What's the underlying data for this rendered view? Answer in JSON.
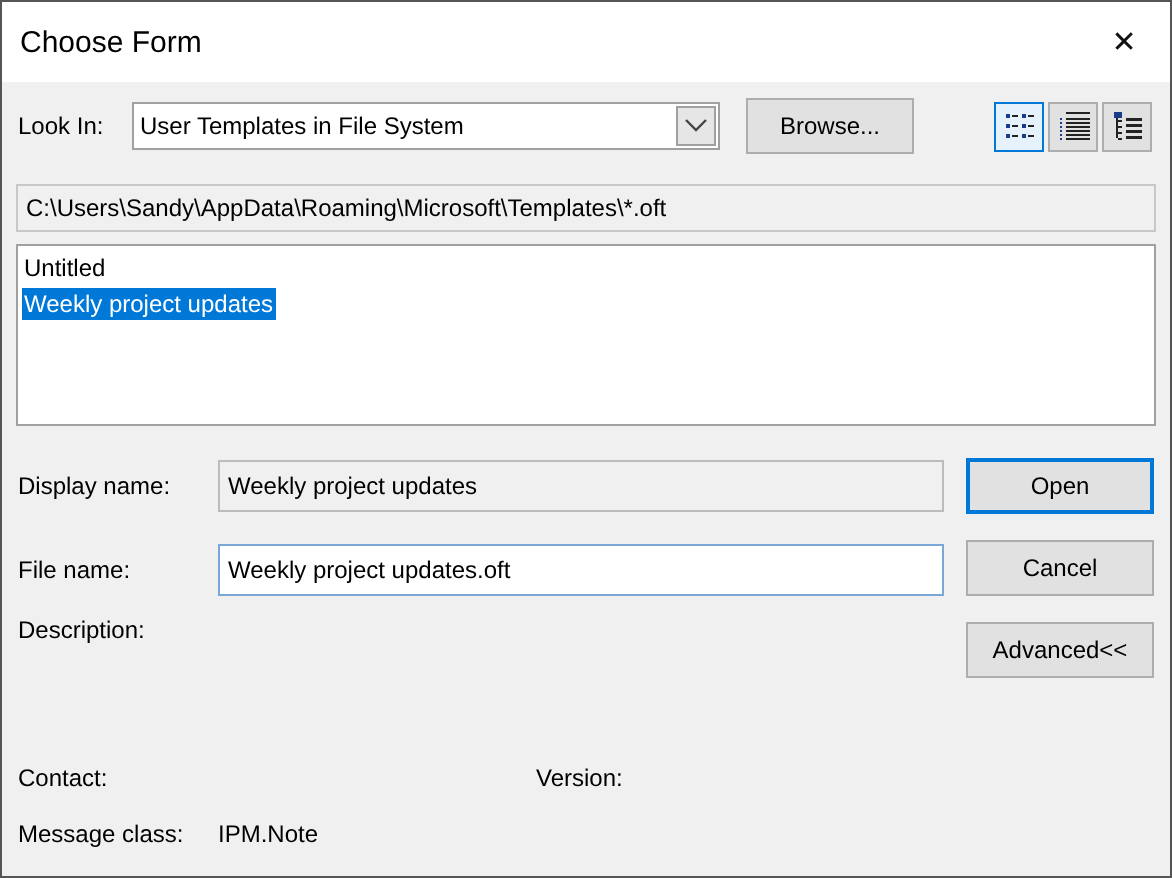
{
  "window": {
    "title": "Choose Form",
    "close": "✕"
  },
  "look_in": {
    "label": "Look In:",
    "value": "User Templates in File System"
  },
  "browse_button": "Browse...",
  "view_buttons": [
    {
      "kind": "list",
      "selected": true
    },
    {
      "kind": "details",
      "selected": false
    },
    {
      "kind": "tree",
      "selected": false
    }
  ],
  "path": "C:\\Users\\Sandy\\AppData\\Roaming\\Microsoft\\Templates\\*.oft",
  "forms": [
    {
      "label": "Untitled",
      "selected": false
    },
    {
      "label": "Weekly project updates",
      "selected": true
    }
  ],
  "display_name": {
    "label": "Display name:",
    "value": "Weekly project updates"
  },
  "file_name": {
    "label": "File name:",
    "value": "Weekly project updates.oft"
  },
  "description": {
    "label": "Description:"
  },
  "buttons": [
    "Open",
    "Cancel",
    "Advanced<<"
  ],
  "contact": {
    "label": "Contact:"
  },
  "version": {
    "label": "Version:"
  },
  "message_class": {
    "label": "Message class:",
    "value": "IPM.Note"
  }
}
